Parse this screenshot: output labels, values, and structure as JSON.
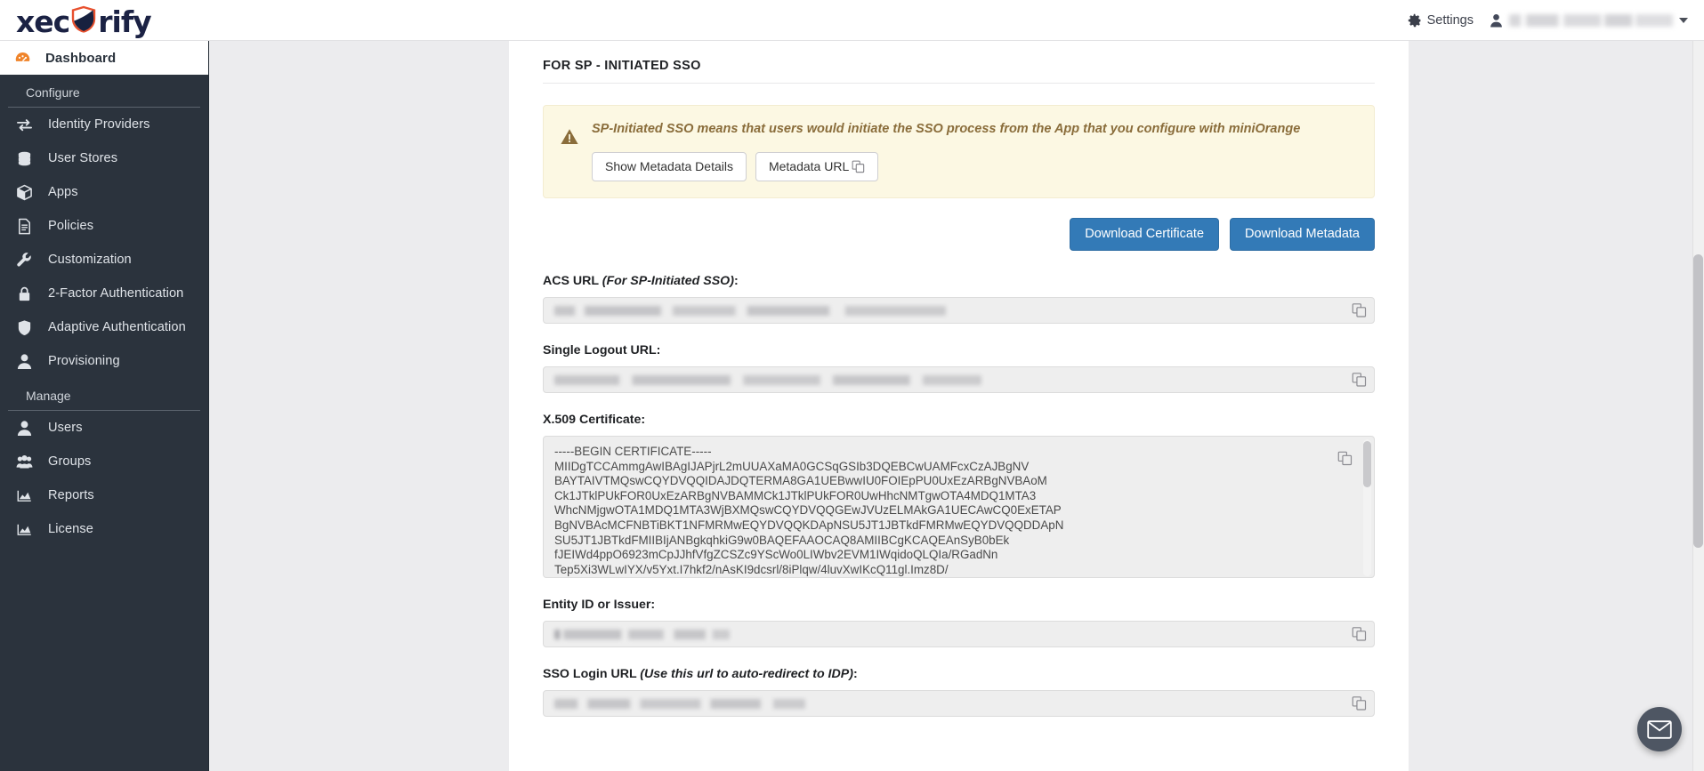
{
  "brand": {
    "logo_text_left": "xec",
    "logo_text_right": "rify",
    "logo_icon": "shield-icon"
  },
  "header": {
    "settings_label": "Settings",
    "user_email": "",
    "gear_icon": "gear-icon",
    "avatar_icon": "avatar-icon",
    "caret_icon": "chevron-down-icon"
  },
  "sidebar": {
    "active_item": {
      "label": "Dashboard",
      "icon": "speedometer-icon"
    },
    "groups": [
      {
        "title": "Configure",
        "items": [
          {
            "label": "Identity Providers",
            "icon": "exchange-arrows-icon"
          },
          {
            "label": "User Stores",
            "icon": "database-icon"
          },
          {
            "label": "Apps",
            "icon": "cube-icon"
          },
          {
            "label": "Policies",
            "icon": "document-icon"
          },
          {
            "label": "Customization",
            "icon": "wrench-icon"
          },
          {
            "label": "2-Factor Authentication",
            "icon": "lock-icon"
          },
          {
            "label": "Adaptive Authentication",
            "icon": "shield-icon"
          },
          {
            "label": "Provisioning",
            "icon": "user-icon"
          }
        ]
      },
      {
        "title": "Manage",
        "items": [
          {
            "label": "Users",
            "icon": "user-icon"
          },
          {
            "label": "Groups",
            "icon": "users-group-icon"
          },
          {
            "label": "Reports",
            "icon": "chart-icon"
          },
          {
            "label": "License",
            "icon": "chart-icon"
          }
        ]
      }
    ]
  },
  "main": {
    "section_title": "FOR SP - INITIATED SSO",
    "alert": {
      "icon": "warning-triangle-icon",
      "text": "SP-Initiated SSO means that users would initiate the SSO process from the App that you configure with miniOrange",
      "buttons": [
        {
          "label": "Show Metadata Details",
          "icon": ""
        },
        {
          "label": "Metadata URL",
          "icon": "copy-icon"
        }
      ]
    },
    "download_buttons": [
      {
        "label": "Download Certificate"
      },
      {
        "label": "Download Metadata"
      }
    ],
    "fields": [
      {
        "label": "ACS URL ",
        "label_italic": "(For SP-Initiated SSO)",
        "label_suffix": ":",
        "value": "",
        "redacted": true,
        "copy_icon": "copy-icon"
      },
      {
        "label": "Single Logout URL",
        "label_italic": "",
        "label_suffix": ":",
        "value": "",
        "redacted": true,
        "copy_icon": "copy-icon"
      },
      {
        "label": "Entity ID or Issuer",
        "label_italic": "",
        "label_suffix": ":",
        "value": "",
        "redacted": true,
        "copy_icon": "copy-icon"
      },
      {
        "label": "SSO Login URL ",
        "label_italic": "(Use this url to auto-redirect to IDP)",
        "label_suffix": ":",
        "value": "",
        "redacted": true,
        "copy_icon": "copy-icon"
      }
    ],
    "certificate": {
      "label": "X.509 Certificate:",
      "copy_icon": "copy-icon",
      "value": "-----BEGIN CERTIFICATE-----\nMIIDgTCCAmmgAwIBAgIJAPjrL2mUUAXaMA0GCSqGSIb3DQEBCwUAMFcxCzAJBgNV\nBAYTAIVTMQswCQYDVQQIDAJDQTERMA8GA1UEBwwIU0FOIEpPU0UxEzARBgNVBAoM\nCk1JTklPUkFOR0UxEzARBgNVBAMMCk1JTklPUkFOR0UwHhcNMTgwOTA4MDQ1MTA3\nWhcNMjgwOTA1MDQ1MTA3WjBXMQswCQYDVQQGEwJVUzELMAkGA1UECAwCQ0ExETAP\nBgNVBAcMCFNBTiBKT1NFMRMwEQYDVQQKDApNSU5JT1JBTkdFMRMwEQYDVQQDDApN\nSU5JT1JBTkdFMIIBIjANBgkqhkiG9w0BAQEFAAOCAQ8AMIIBCgKCAQEAnSyB0bEk\nfJEIWd4ppO6923mCpJJhfVfgZCSZc9YScWo0LIWbv2EVM1IWqidoQLQIa/RGadNn\nTep5Xi3WLwIYX/v5Yxt.I7hkf2/nAsKI9dcsrl/8iPlqw/4luvXwIKcQ11gl.Imz8D/"
    }
  },
  "fab": {
    "icon": "mail-icon",
    "label": ""
  }
}
